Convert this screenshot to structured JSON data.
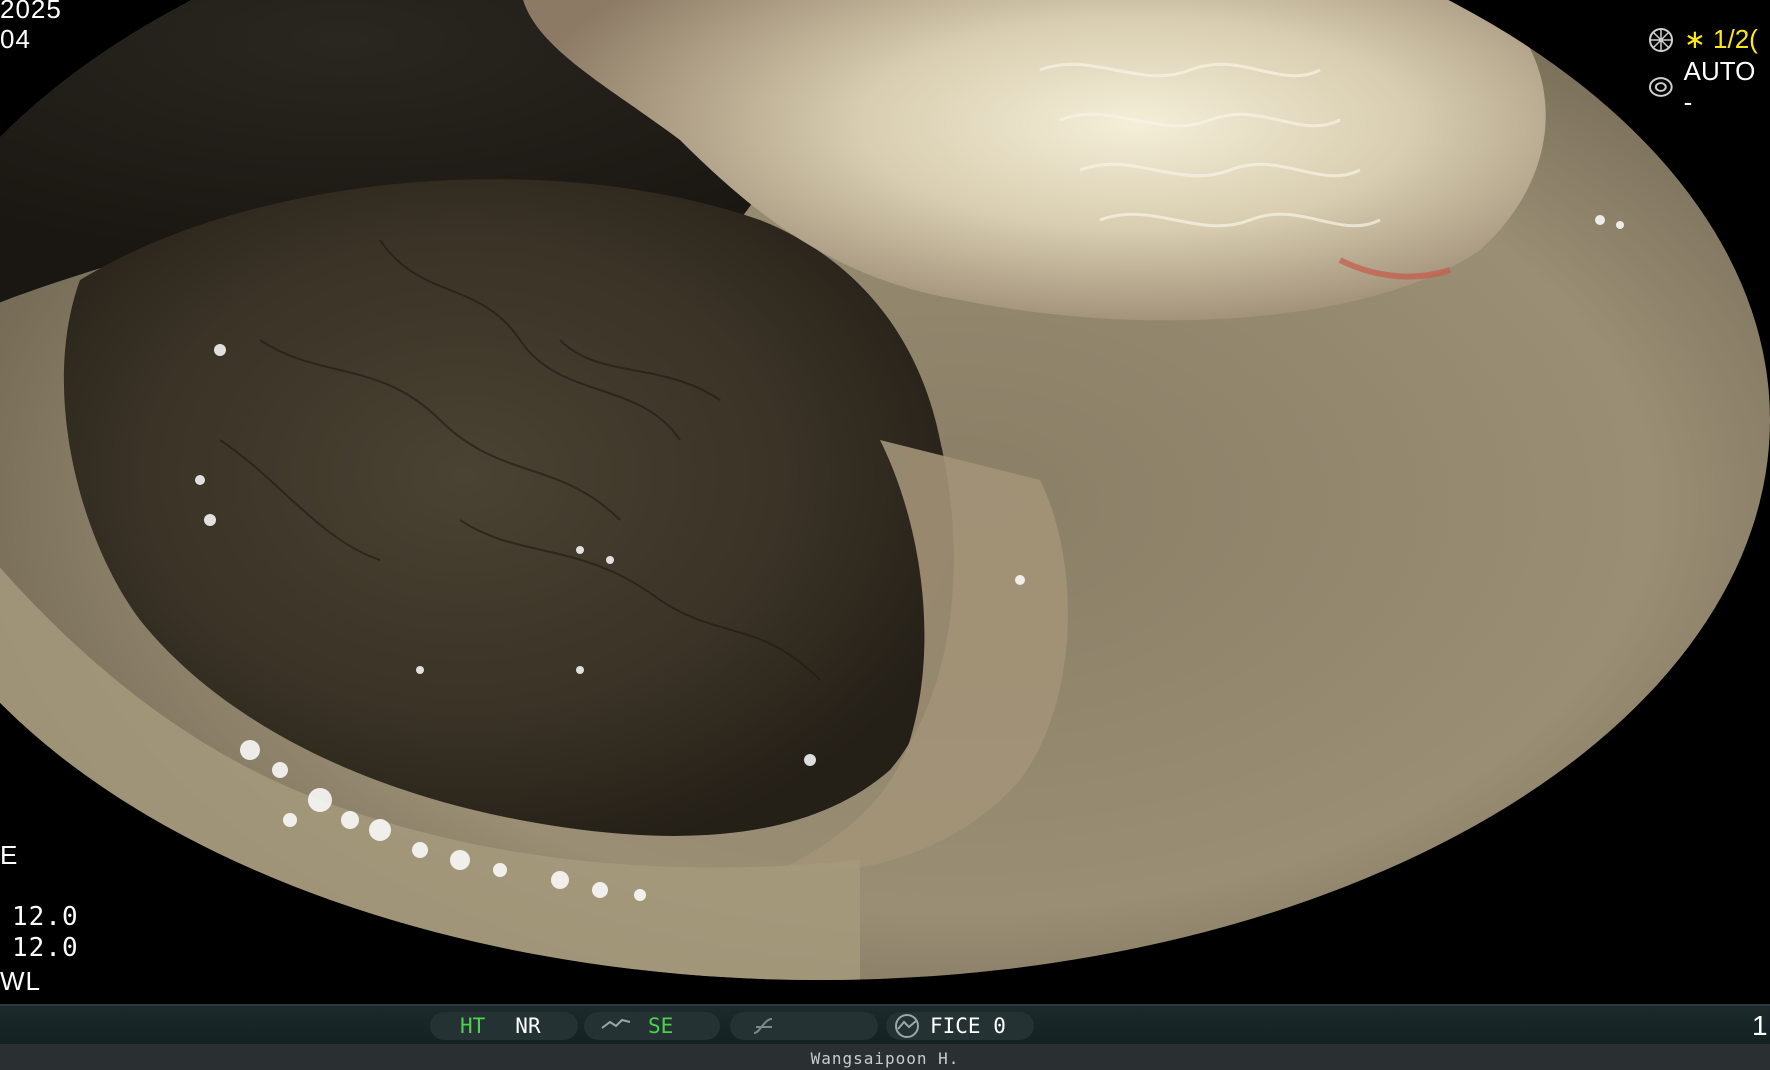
{
  "overlay_top_left": {
    "date_fragment": "2025",
    "time_fragment": "04"
  },
  "overlay_bottom_left": {
    "mode_fragment": "E",
    "value1": "12.0",
    "value2": "12.0",
    "light_fragment": "WL"
  },
  "overlay_top_right": {
    "shutter_value": "∗ 1/2(",
    "iris_mode": "AUTO -",
    "colors": {
      "shutter_text": "#ffe81a",
      "iris_text": "#ffffff"
    }
  },
  "status_bar": {
    "ht_label": "HT",
    "nr_label": "NR",
    "se_label": "SE",
    "fice_label": "FICE 0",
    "right_number": "1",
    "colors": {
      "active": "#4cd24c",
      "text": "#ffffff",
      "bar": "#1c2a2c"
    }
  },
  "operator": {
    "name": "Wangsaipoon H."
  },
  "icons": [
    "shutter-icon",
    "iris-icon",
    "enhance-icon",
    "curve-icon",
    "fice-icon"
  ]
}
